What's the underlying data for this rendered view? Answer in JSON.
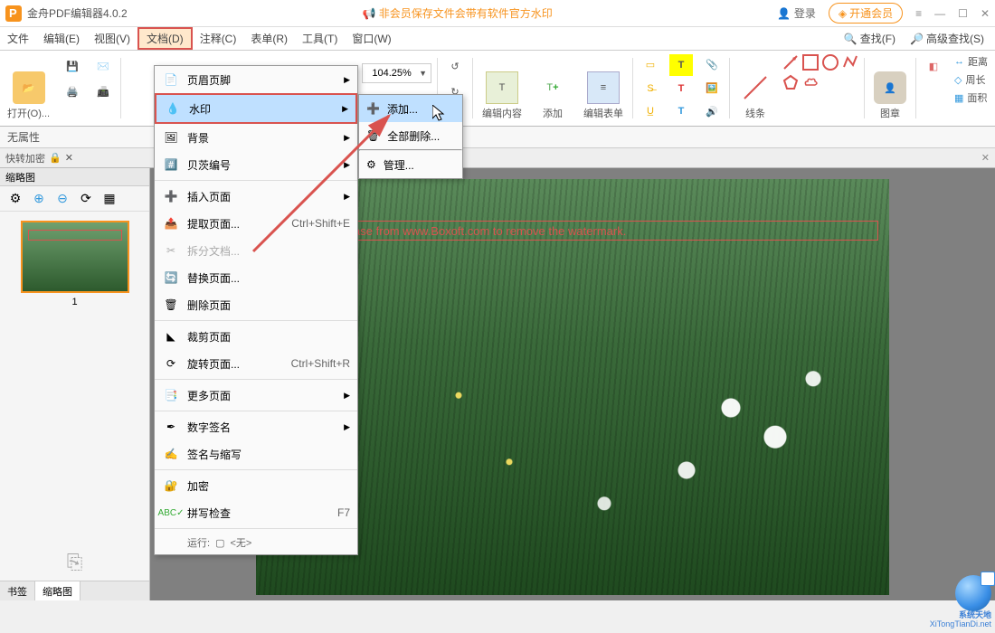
{
  "titlebar": {
    "app_title": "金舟PDF编辑器4.0.2",
    "notice": "非会员保存文件会带有软件官方水印",
    "login": "登录",
    "vip": "开通会员"
  },
  "menubar": {
    "items": [
      {
        "label": "文件"
      },
      {
        "label": "编辑(E)"
      },
      {
        "label": "视图(V)"
      },
      {
        "label": "文档(D)"
      },
      {
        "label": "注释(C)"
      },
      {
        "label": "表单(R)"
      },
      {
        "label": "工具(T)"
      },
      {
        "label": "窗口(W)"
      }
    ],
    "find": "查找(F)",
    "adv_find": "高级查找(S)"
  },
  "ribbon": {
    "open": "打开(O)...",
    "zoom_value": "104.25%",
    "edit_content": "编辑内容",
    "add": "添加",
    "edit_form": "编辑表单",
    "lines": "线条",
    "stamp": "图章",
    "meas_distance": "距离",
    "meas_perimeter": "周长",
    "meas_area": "面积"
  },
  "props": {
    "none": "无属性"
  },
  "panelbar": {
    "quick_encrypt": "快转加密"
  },
  "sidebar": {
    "title": "缩略图",
    "page_num": "1",
    "tab_bookmark": "书签",
    "tab_thumb": "缩略图"
  },
  "doc_menu": {
    "items": [
      {
        "label": "页眉页脚",
        "arrow": true
      },
      {
        "label": "水印",
        "arrow": true,
        "hover": true
      },
      {
        "label": "背景",
        "arrow": true
      },
      {
        "label": "贝茨编号",
        "arrow": true
      },
      {
        "label": "插入页面",
        "arrow": true
      },
      {
        "label": "提取页面...",
        "sc": "Ctrl+Shift+E"
      },
      {
        "label": "拆分文档...",
        "disabled": true
      },
      {
        "label": "替换页面..."
      },
      {
        "label": "删除页面"
      },
      {
        "label": "裁剪页面"
      },
      {
        "label": "旋转页面...",
        "sc": "Ctrl+Shift+R"
      },
      {
        "label": "更多页面",
        "arrow": true
      },
      {
        "label": "数字签名",
        "arrow": true
      },
      {
        "label": "签名与缩写"
      },
      {
        "label": "加密"
      },
      {
        "label": "拼写检查",
        "sc": "F7"
      }
    ],
    "run_label": "运行:",
    "run_value": "<无>"
  },
  "watermark_submenu": {
    "add": "添加...",
    "delete_all": "全部删除...",
    "manage": "管理..."
  },
  "canvas": {
    "watermark_text": "® Demo. Purchase from www.Boxoft.com to remove the watermark."
  },
  "brand": {
    "line1": "系统天地",
    "line2": "XiTongTianDi.net"
  }
}
